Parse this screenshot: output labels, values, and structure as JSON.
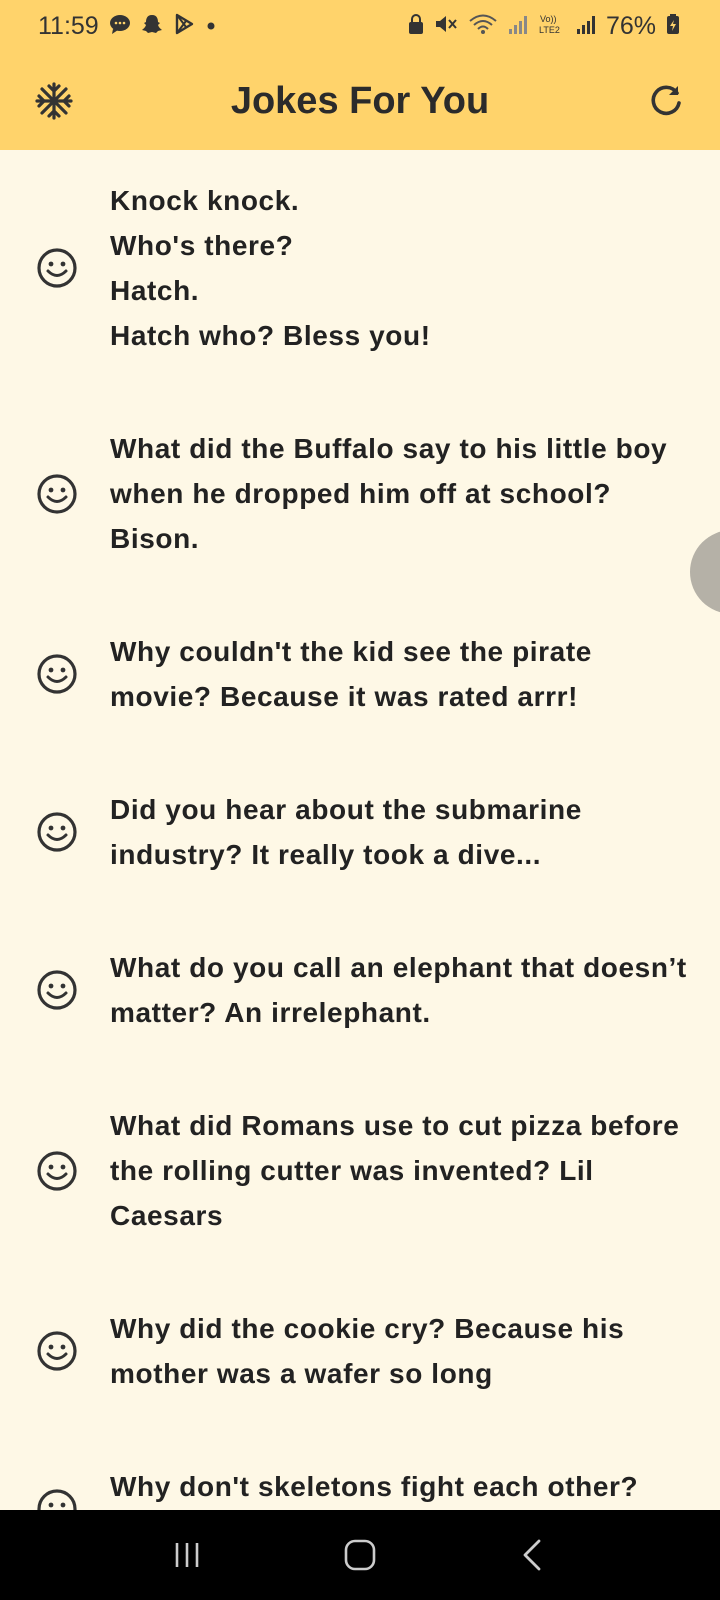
{
  "status_bar": {
    "time": "11:59",
    "battery": "76%",
    "left_icons": [
      "chat-bubble-icon",
      "snapchat-icon",
      "play-store-icon",
      "dot-icon"
    ],
    "right_icons": [
      "lock-icon",
      "mute-icon",
      "wifi-icon",
      "signal-icon",
      "volte-icon",
      "signal-icon",
      "battery-icon"
    ]
  },
  "app_bar": {
    "title": "Jokes For You",
    "left_icon": "snowflake-icon",
    "right_icon": "refresh-icon",
    "background": "#FFD36B"
  },
  "jokes": [
    {
      "text": "Knock knock.\n Who's there?\n Hatch.\n Hatch who? Bless you!",
      "icon": "smiley-icon"
    },
    {
      "text": "What did the Buffalo say to his little boy when he dropped him off at school? Bison.",
      "icon": "smiley-icon"
    },
    {
      "text": "Why couldn't the kid see the pirate movie? Because it was rated arrr!",
      "icon": "smiley-icon"
    },
    {
      "text": "Did you hear about the submarine industry? It really took a dive...",
      "icon": "smiley-icon"
    },
    {
      "text": "What do you call an elephant that doesn’t matter? An irrelephant.",
      "icon": "smiley-icon"
    },
    {
      "text": "What did Romans use to cut pizza before the rolling cutter was invented? Lil Caesars",
      "icon": "smiley-icon"
    },
    {
      "text": "Why did the cookie cry? Because his mother was a wafer so long",
      "icon": "smiley-icon"
    },
    {
      "text": "Why don't skeletons fight each other? They don't have the guts.",
      "icon": "smiley-icon"
    }
  ],
  "nav_bar": {
    "buttons": [
      "recent-apps-icon",
      "home-icon",
      "back-icon"
    ]
  },
  "colors": {
    "accent": "#FFD36B",
    "background": "#FEF8E6",
    "text": "#222222"
  }
}
